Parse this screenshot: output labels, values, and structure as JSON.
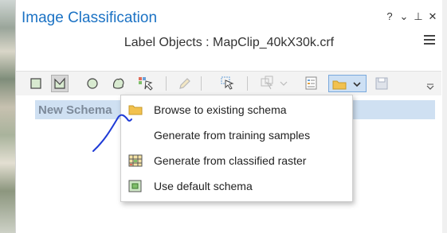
{
  "window": {
    "title": "Image Classification",
    "controls": [
      "?",
      "⌄",
      "⊥",
      "✕"
    ],
    "subtitle": "Label Objects : MapClip_40kX30k.crf"
  },
  "toolbar": {
    "tools": [
      "rectangle-icon",
      "polygon-icon",
      "circle-icon",
      "freehand-icon",
      "segment-picker-icon",
      "edit-pencil-icon",
      "select-arrow-icon",
      "label-picker-icon",
      "properties-icon",
      "folder-open-icon",
      "chevron-down-icon",
      "save-icon",
      "overflow-chevron-icon"
    ]
  },
  "schema": {
    "name": "New Schema"
  },
  "dropdown": {
    "items": [
      {
        "label": "Browse to existing schema",
        "icon": "folder-icon"
      },
      {
        "label": "Generate from training samples",
        "icon": ""
      },
      {
        "label": "Generate from classified raster",
        "icon": "raster-grid-icon"
      },
      {
        "label": "Use default schema",
        "icon": "default-schema-icon"
      }
    ]
  },
  "colors": {
    "title": "#1b72c4",
    "highlight": "#cfe0f2",
    "annotation_ink": "#1f3bd6",
    "folder": "#f2c14e"
  }
}
